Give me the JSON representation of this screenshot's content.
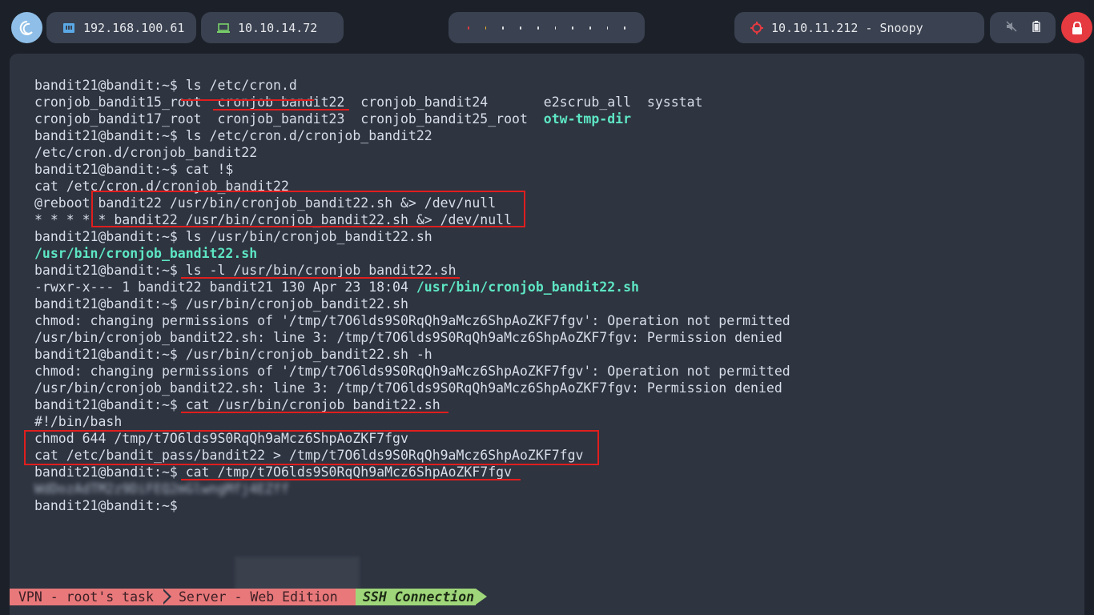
{
  "topbar": {
    "ip_local": "192.168.100.61",
    "ip_vpn": "10.10.14.72",
    "target": "10.10.11.212 - Snoopy",
    "workspace_dot_colors": [
      "#e53a40",
      "#f0b429",
      "#e6e8ec",
      "#e6e8ec",
      "#e6e8ec",
      "#e6e8ec",
      "#e6e8ec",
      "#e6e8ec",
      "#e6e8ec",
      "#e6e8ec"
    ]
  },
  "terminal": {
    "lines": [
      {
        "prompt": "bandit21@bandit:~$ ",
        "text": "ls /etc/cron.d"
      },
      {
        "text": "cronjob_bandit15_root  cronjob_bandit22  cronjob_bandit24       e2scrub_all  sysstat"
      },
      {
        "text": "cronjob_bandit17_root  cronjob_bandit23  cronjob_bandit25_root  ",
        "bold": "otw-tmp-dir"
      },
      {
        "prompt": "bandit21@bandit:~$ ",
        "text": "ls /etc/cron.d/cronjob_bandit22"
      },
      {
        "text": "/etc/cron.d/cronjob_bandit22"
      },
      {
        "prompt": "bandit21@bandit:~$ ",
        "text": "cat !$"
      },
      {
        "text": "cat /etc/cron.d/cronjob_bandit22"
      },
      {
        "text": "@reboot bandit22 /usr/bin/cronjob_bandit22.sh &> /dev/null"
      },
      {
        "text": "* * * * * bandit22 /usr/bin/cronjob_bandit22.sh &> /dev/null"
      },
      {
        "prompt": "bandit21@bandit:~$ ",
        "text": "ls /usr/bin/cronjob_bandit22.sh"
      },
      {
        "text": "",
        "bold": "/usr/bin/cronjob_bandit22.sh"
      },
      {
        "prompt": "bandit21@bandit:~$ ",
        "text": "ls -l /usr/bin/cronjob_bandit22.sh"
      },
      {
        "text": "-rwxr-x--- 1 bandit22 bandit21 130 Apr 23 18:04 ",
        "bold": "/usr/bin/cronjob_bandit22.sh"
      },
      {
        "prompt": "bandit21@bandit:~$ ",
        "text": "/usr/bin/cronjob_bandit22.sh"
      },
      {
        "text": "chmod: changing permissions of '/tmp/t7O6lds9S0RqQh9aMcz6ShpAoZKF7fgv': Operation not permitted"
      },
      {
        "text": "/usr/bin/cronjob_bandit22.sh: line 3: /tmp/t7O6lds9S0RqQh9aMcz6ShpAoZKF7fgv: Permission denied"
      },
      {
        "prompt": "bandit21@bandit:~$ ",
        "text": "/usr/bin/cronjob_bandit22.sh -h"
      },
      {
        "text": "chmod: changing permissions of '/tmp/t7O6lds9S0RqQh9aMcz6ShpAoZKF7fgv': Operation not permitted"
      },
      {
        "text": "/usr/bin/cronjob_bandit22.sh: line 3: /tmp/t7O6lds9S0RqQh9aMcz6ShpAoZKF7fgv: Permission denied"
      },
      {
        "prompt": "bandit21@bandit:~$ ",
        "text": "cat /usr/bin/cronjob_bandit22.sh"
      },
      {
        "text": "#!/bin/bash"
      },
      {
        "text": "chmod 644 /tmp/t7O6lds9S0RqQh9aMcz6ShpAoZKF7fgv"
      },
      {
        "text": "cat /etc/bandit_pass/bandit22 > /tmp/t7O6lds9S0RqQh9aMcz6ShpAoZKF7fgv"
      },
      {
        "prompt": "bandit21@bandit:~$ ",
        "text": "cat /tmp/t7O6lds9S0RqQh9aMcz6ShpAoZKF7fgv"
      },
      {
        "text": "WdDozAdTM2z9DiFEQ2mGlwngMfj4EZff",
        "blurred": true
      },
      {
        "prompt": "bandit21@bandit:~$ ",
        "text": ""
      }
    ]
  },
  "statusbar": {
    "segment_1": "VPN - root's task",
    "segment_2": "Server - Web Edition",
    "segment_3": "SSH Connection"
  }
}
